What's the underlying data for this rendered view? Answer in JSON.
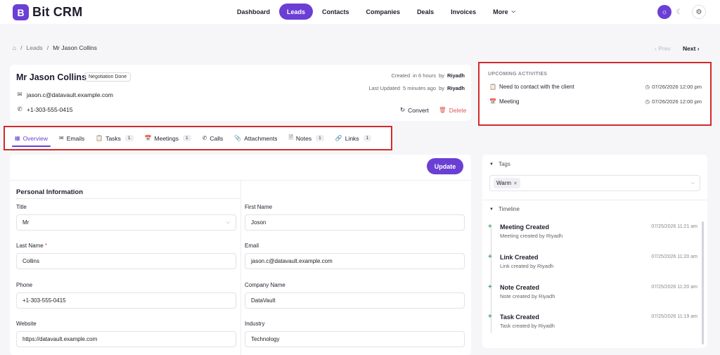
{
  "app": {
    "logo_letter": "B",
    "name": "Bit CRM"
  },
  "nav": {
    "items": [
      {
        "label": "Dashboard"
      },
      {
        "label": "Leads"
      },
      {
        "label": "Contacts"
      },
      {
        "label": "Companies"
      },
      {
        "label": "Deals"
      },
      {
        "label": "Invoices"
      },
      {
        "label": "More"
      }
    ],
    "active": "Leads"
  },
  "breadcrumb": {
    "items": [
      "Leads",
      "Mr Jason Collins"
    ],
    "separator": "/"
  },
  "pager": {
    "prev": "Prev",
    "next": "Next"
  },
  "lead": {
    "name": "Mr Jason Collins",
    "stage": "Negotiation Done",
    "email": "jason.c@datavault.example.com",
    "phone": "+1-303-555-0415",
    "created_label": "Created",
    "created_ago": "in 6 hours",
    "by_label": "by",
    "created_by": "Riyadh",
    "updated_label": "Last Updated",
    "updated_ago": "5 minutes ago",
    "updated_by": "Riyadh",
    "convert_label": "Convert",
    "delete_label": "Delete"
  },
  "upcoming": {
    "title": "UPCOMING ACTIVITIES",
    "items": [
      {
        "label": "Need to contact with the client",
        "time": "07/26/2026 12:00 pm"
      },
      {
        "label": "Meeting",
        "time": "07/26/2026 12:00 pm"
      }
    ]
  },
  "tabs": [
    {
      "label": "Overview",
      "count": ""
    },
    {
      "label": "Emails",
      "count": ""
    },
    {
      "label": "Tasks",
      "count": "1"
    },
    {
      "label": "Meetings",
      "count": "1"
    },
    {
      "label": "Calls",
      "count": ""
    },
    {
      "label": "Attachments",
      "count": ""
    },
    {
      "label": "Notes",
      "count": "1"
    },
    {
      "label": "Links",
      "count": "1"
    }
  ],
  "form": {
    "update_label": "Update",
    "section_title": "Personal Information",
    "fields": {
      "title": {
        "label": "Title",
        "value": "Mr"
      },
      "first_name": {
        "label": "First Name",
        "value": "Joson"
      },
      "last_name": {
        "label": "Last Name",
        "value": "Collins",
        "required_mark": "*"
      },
      "email": {
        "label": "Email",
        "value": "jason.c@datavault.example.com"
      },
      "phone": {
        "label": "Phone",
        "value": "+1-303-555-0415"
      },
      "company": {
        "label": "Company Name",
        "value": "DataVault"
      },
      "website": {
        "label": "Website",
        "value": "https://datavault.example.com"
      },
      "industry": {
        "label": "Industry",
        "value": "Technology"
      }
    }
  },
  "tags": {
    "title": "Tags",
    "items": [
      "Warm"
    ]
  },
  "timeline": {
    "title": "Timeline",
    "items": [
      {
        "title": "Meeting Created",
        "desc": "Meeting created by Riyadh",
        "time": "07/25/2026 11:21 am"
      },
      {
        "title": "Link Created",
        "desc": "Link created by Riyadh",
        "time": "07/25/2026 11:20 am"
      },
      {
        "title": "Note Created",
        "desc": "Note created by Riyadh",
        "time": "07/25/2026 11:20 am"
      },
      {
        "title": "Task Created",
        "desc": "Task created by Riyadh",
        "time": "07/25/2026 11:19 am"
      }
    ]
  },
  "colors": {
    "accent": "#6b3fd4",
    "danger": "#e05656",
    "highlight_box": "#d32a2a",
    "timeline_plus": "#49a36a"
  }
}
